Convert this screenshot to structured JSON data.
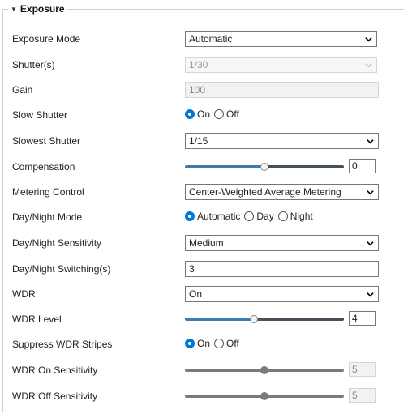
{
  "section": {
    "title": "Exposure"
  },
  "rows": {
    "exposure_mode": {
      "label": "Exposure Mode",
      "value": "Automatic"
    },
    "shutter": {
      "label": "Shutter(s)",
      "value": "1/30"
    },
    "gain": {
      "label": "Gain",
      "value": "100"
    },
    "slow_shutter": {
      "label": "Slow Shutter",
      "options": [
        "On",
        "Off"
      ],
      "selected": "On"
    },
    "slowest_shutter": {
      "label": "Slowest Shutter",
      "value": "1/15"
    },
    "compensation": {
      "label": "Compensation",
      "value": "0",
      "level": 0.5
    },
    "metering_control": {
      "label": "Metering Control",
      "value": "Center-Weighted Average Metering"
    },
    "day_night_mode": {
      "label": "Day/Night Mode",
      "options": [
        "Automatic",
        "Day",
        "Night"
      ],
      "selected": "Automatic"
    },
    "day_night_sensitivity": {
      "label": "Day/Night Sensitivity",
      "value": "Medium"
    },
    "day_night_switching": {
      "label": "Day/Night Switching(s)",
      "value": "3"
    },
    "wdr": {
      "label": "WDR",
      "value": "On"
    },
    "wdr_level": {
      "label": "WDR Level",
      "value": "4",
      "level": 0.43
    },
    "suppress_wdr_stripes": {
      "label": "Suppress WDR Stripes",
      "options": [
        "On",
        "Off"
      ],
      "selected": "On"
    },
    "wdr_on_sensitivity": {
      "label": "WDR On Sensitivity",
      "value": "5",
      "level": 0.5
    },
    "wdr_off_sensitivity": {
      "label": "WDR Off Sensitivity",
      "value": "5",
      "level": 0.5
    }
  },
  "colors": {
    "accent": "#0078d4",
    "slider_fill": "#3c7cb4",
    "slider_track": "#45505a"
  },
  "icons": {
    "dropdown": "chevron-down-icon",
    "collapse": "caret-down-icon"
  }
}
